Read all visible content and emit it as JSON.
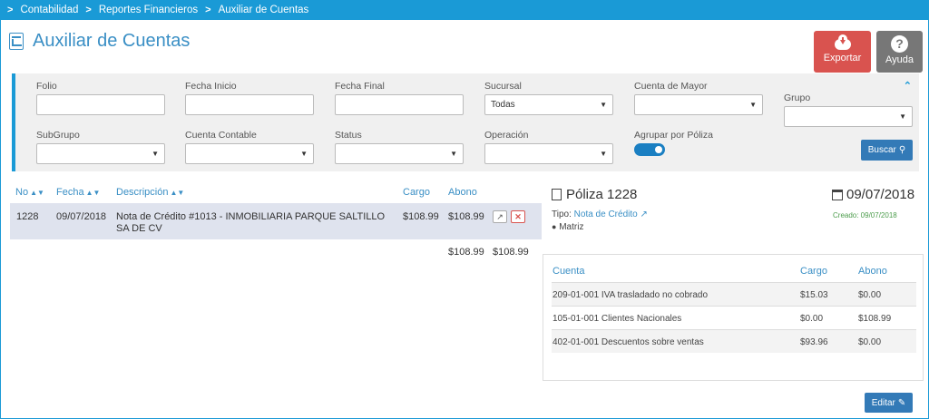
{
  "breadcrumb": {
    "items": [
      "Contabilidad",
      "Reportes Financieros",
      "Auxiliar de Cuentas"
    ],
    "separator": ">"
  },
  "page": {
    "title": "Auxiliar de Cuentas"
  },
  "actions": {
    "export_label": "Exportar",
    "help_label": "Ayuda"
  },
  "filters": {
    "folio": {
      "label": "Folio",
      "value": ""
    },
    "fecha_inicio": {
      "label": "Fecha Inicio",
      "value": ""
    },
    "fecha_final": {
      "label": "Fecha Final",
      "value": ""
    },
    "sucursal": {
      "label": "Sucursal",
      "value": "Todas"
    },
    "cuenta_mayor": {
      "label": "Cuenta de Mayor",
      "value": ""
    },
    "grupo": {
      "label": "Grupo",
      "value": ""
    },
    "subgrupo": {
      "label": "SubGrupo",
      "value": ""
    },
    "cuenta_contable": {
      "label": "Cuenta Contable",
      "value": ""
    },
    "status": {
      "label": "Status",
      "value": ""
    },
    "operacion": {
      "label": "Operación",
      "value": ""
    },
    "agrupar": {
      "label": "Agrupar por Póliza",
      "checked": true
    },
    "search_label": "Buscar"
  },
  "table": {
    "headers": {
      "no": "No",
      "fecha": "Fecha",
      "descripcion": "Descripción",
      "cargo": "Cargo",
      "abono": "Abono"
    },
    "rows": [
      {
        "no": "1228",
        "fecha": "09/07/2018",
        "descripcion": "Nota de Crédito #1013 - INMOBILIARIA PARQUE SALTILLO SA DE CV",
        "cargo": "$108.99",
        "abono": "$108.99"
      }
    ],
    "totals": {
      "cargo": "$108.99",
      "abono": "$108.99"
    }
  },
  "poliza": {
    "title": "Póliza 1228",
    "date": "09/07/2018",
    "tipo_label": "Tipo:",
    "tipo_value": "Nota de Crédito",
    "creado": "Creado: 09/07/2018",
    "sucursal": "Matriz",
    "headers": {
      "cuenta": "Cuenta",
      "cargo": "Cargo",
      "abono": "Abono"
    },
    "rows": [
      {
        "cuenta": "209-01-001 IVA trasladado no cobrado",
        "cargo": "$15.03",
        "abono": "$0.00"
      },
      {
        "cuenta": "105-01-001 Clientes Nacionales",
        "cargo": "$0.00",
        "abono": "$108.99"
      },
      {
        "cuenta": "402-01-001 Descuentos sobre ventas",
        "cargo": "$93.96",
        "abono": "$0.00"
      }
    ],
    "edit_label": "Editar"
  },
  "colors": {
    "primary": "#1a9ad6",
    "danger": "#d9534f",
    "button": "#337ab7",
    "muted": "#777777"
  }
}
